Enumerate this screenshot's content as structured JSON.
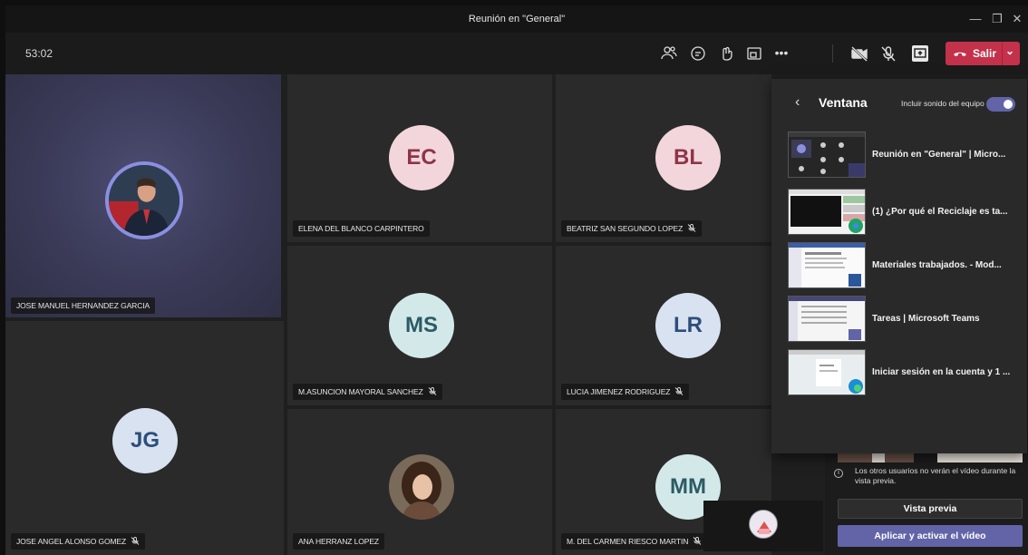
{
  "window": {
    "title": "Reunión en \"General\""
  },
  "toolbar": {
    "timer": "53:02",
    "leave_label": "Salir"
  },
  "participants": [
    {
      "name": "JOSE MANUEL HERNANDEZ GARCIA",
      "muted": false
    },
    {
      "name": "ELENA DEL BLANCO CARPINTERO",
      "initials": "EC",
      "muted": false
    },
    {
      "name": "BEATRIZ SAN SEGUNDO LOPEZ",
      "initials": "BL",
      "muted": true
    },
    {
      "name": "M.ASUNCION MAYORAL SANCHEZ",
      "initials": "MS",
      "muted": true
    },
    {
      "name": "LUCIA JIMENEZ RODRIGUEZ",
      "initials": "LR",
      "muted": true
    },
    {
      "name": "JOSE ANGEL ALONSO GOMEZ",
      "initials": "JG",
      "muted": true
    },
    {
      "name": "ANA HERRANZ LOPEZ",
      "muted": false
    },
    {
      "name": "M. DEL CARMEN RIESCO MARTIN",
      "initials": "MM",
      "muted": true
    }
  ],
  "share_panel": {
    "title": "Ventana",
    "include_sound_label": "Incluir sonido del equipo",
    "include_sound_on": true,
    "windows": [
      {
        "title": "Reunión en \"General\" | Micro..."
      },
      {
        "title": "(1) ¿Por qué el Reciclaje es ta..."
      },
      {
        "title": "Materiales trabajados. - Mod..."
      },
      {
        "title": "Tareas | Microsoft Teams"
      },
      {
        "title": "Iniciar sesión en la cuenta y 1 ..."
      }
    ]
  },
  "video_preview": {
    "info": "Los otros usuarios no verán el vídeo durante la vista previa.",
    "preview_label": "Vista previa",
    "apply_label": "Aplicar y activar el vídeo"
  },
  "colors": {
    "accent": "#6264a7",
    "leave": "#c4314b"
  }
}
